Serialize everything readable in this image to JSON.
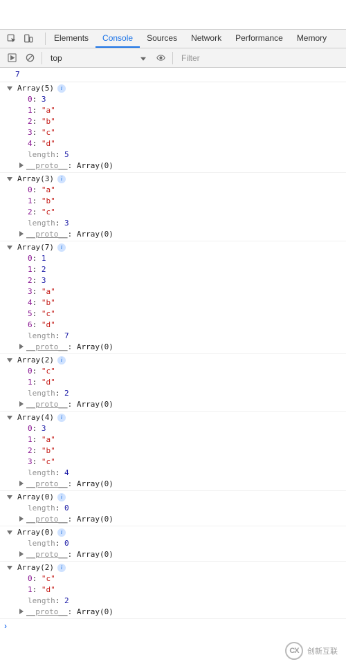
{
  "tabs": {
    "elements": "Elements",
    "console": "Console",
    "sources": "Sources",
    "network": "Network",
    "performance": "Performance",
    "memory": "Memory"
  },
  "filter": {
    "context": "top",
    "placeholder": "Filter"
  },
  "first_output": "7",
  "arrays": [
    {
      "label": "Array",
      "size": "5",
      "items": [
        {
          "k": "0",
          "v": "3",
          "t": "num"
        },
        {
          "k": "1",
          "v": "\"a\"",
          "t": "str"
        },
        {
          "k": "2",
          "v": "\"b\"",
          "t": "str"
        },
        {
          "k": "3",
          "v": "\"c\"",
          "t": "str"
        },
        {
          "k": "4",
          "v": "\"d\"",
          "t": "str"
        }
      ],
      "length": "5",
      "proto": "Array(0)"
    },
    {
      "label": "Array",
      "size": "3",
      "items": [
        {
          "k": "0",
          "v": "\"a\"",
          "t": "str"
        },
        {
          "k": "1",
          "v": "\"b\"",
          "t": "str"
        },
        {
          "k": "2",
          "v": "\"c\"",
          "t": "str"
        }
      ],
      "length": "3",
      "proto": "Array(0)"
    },
    {
      "label": "Array",
      "size": "7",
      "items": [
        {
          "k": "0",
          "v": "1",
          "t": "num"
        },
        {
          "k": "1",
          "v": "2",
          "t": "num"
        },
        {
          "k": "2",
          "v": "3",
          "t": "num"
        },
        {
          "k": "3",
          "v": "\"a\"",
          "t": "str"
        },
        {
          "k": "4",
          "v": "\"b\"",
          "t": "str"
        },
        {
          "k": "5",
          "v": "\"c\"",
          "t": "str"
        },
        {
          "k": "6",
          "v": "\"d\"",
          "t": "str"
        }
      ],
      "length": "7",
      "proto": "Array(0)"
    },
    {
      "label": "Array",
      "size": "2",
      "items": [
        {
          "k": "0",
          "v": "\"c\"",
          "t": "str"
        },
        {
          "k": "1",
          "v": "\"d\"",
          "t": "str"
        }
      ],
      "length": "2",
      "proto": "Array(0)"
    },
    {
      "label": "Array",
      "size": "4",
      "items": [
        {
          "k": "0",
          "v": "3",
          "t": "num"
        },
        {
          "k": "1",
          "v": "\"a\"",
          "t": "str"
        },
        {
          "k": "2",
          "v": "\"b\"",
          "t": "str"
        },
        {
          "k": "3",
          "v": "\"c\"",
          "t": "str"
        }
      ],
      "length": "4",
      "proto": "Array(0)"
    },
    {
      "label": "Array",
      "size": "0",
      "items": [],
      "length": "0",
      "proto": "Array(0)"
    },
    {
      "label": "Array",
      "size": "0",
      "items": [],
      "length": "0",
      "proto": "Array(0)"
    },
    {
      "label": "Array",
      "size": "2",
      "items": [
        {
          "k": "0",
          "v": "\"c\"",
          "t": "str"
        },
        {
          "k": "1",
          "v": "\"d\"",
          "t": "str"
        }
      ],
      "length": "2",
      "proto": "Array(0)"
    }
  ],
  "labels": {
    "length_key": "length",
    "proto_key": "__proto__"
  },
  "watermark": {
    "logo": "CX",
    "text": "创新互联"
  }
}
